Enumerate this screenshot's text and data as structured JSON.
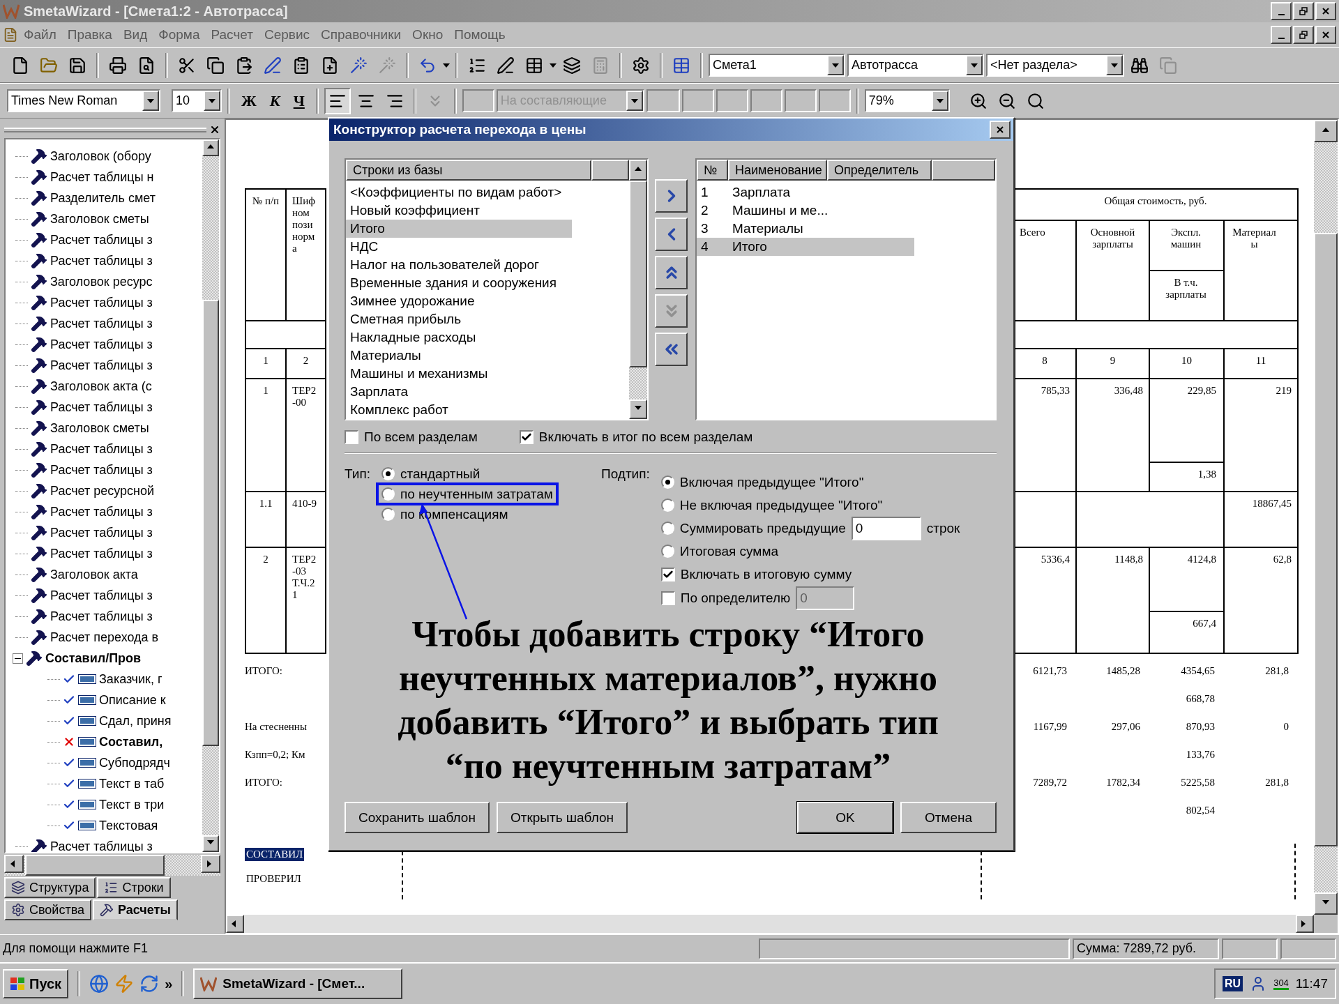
{
  "window": {
    "title": "SmetaWizard - [Смета1:2 - Автотрасса]"
  },
  "menu": [
    "Файл",
    "Правка",
    "Вид",
    "Форма",
    "Расчет",
    "Сервис",
    "Справочники",
    "Окно",
    "Помощь"
  ],
  "toolbar": {
    "combos": [
      {
        "value": "Смета1"
      },
      {
        "value": "Автотрасса"
      },
      {
        "value": "<Нет раздела>"
      }
    ]
  },
  "format_bar": {
    "font": "Times New Roman",
    "size": "10",
    "styles": [
      {
        "label": "Ж",
        "kind": "bold"
      },
      {
        "label": "К",
        "kind": "italic"
      },
      {
        "label": "Ч",
        "kind": "underline"
      }
    ],
    "alignment": [
      {
        "kind": "left",
        "selected": true
      },
      {
        "kind": "center",
        "selected": false
      },
      {
        "kind": "right",
        "selected": false
      }
    ],
    "component_combo": {
      "value": "На составляющие",
      "disabled": true
    },
    "zoom": "79%"
  },
  "tree": {
    "items": [
      {
        "label": "Заголовок (обору",
        "bold": false
      },
      {
        "label": "Расчет таблицы н",
        "bold": false
      },
      {
        "label": "Разделитель смет",
        "bold": false
      },
      {
        "label": "Заголовок сметы",
        "bold": false
      },
      {
        "label": "Расчет таблицы з",
        "bold": false
      },
      {
        "label": "Расчет таблицы з",
        "bold": false
      },
      {
        "label": "Заголовок ресурс",
        "bold": false
      },
      {
        "label": "Расчет таблицы з",
        "bold": false
      },
      {
        "label": "Расчет таблицы з",
        "bold": false
      },
      {
        "label": "Расчет таблицы з",
        "bold": false
      },
      {
        "label": "Расчет таблицы з",
        "bold": false
      },
      {
        "label": "Заголовок акта (с",
        "bold": false
      },
      {
        "label": "Расчет таблицы з",
        "bold": false
      },
      {
        "label": "Заголовок сметы",
        "bold": false
      },
      {
        "label": "Расчет таблицы з",
        "bold": false
      },
      {
        "label": "Расчет таблицы з",
        "bold": false
      },
      {
        "label": "Расчет ресурсной",
        "bold": false
      },
      {
        "label": "Расчет таблицы з",
        "bold": false
      },
      {
        "label": "Расчет таблицы з",
        "bold": false
      },
      {
        "label": "Расчет таблицы з",
        "bold": false
      },
      {
        "label": "Заголовок акта",
        "bold": false
      },
      {
        "label": "Расчет таблицы з",
        "bold": false
      },
      {
        "label": "Расчет таблицы з",
        "bold": false
      },
      {
        "label": "Расчет перехода в",
        "bold": false
      },
      {
        "label": "Составил/Пров",
        "bold": true,
        "expanded": true,
        "children": [
          {
            "label": "Заказчик, г",
            "kind": "ok",
            "bold": false
          },
          {
            "label": "Описание к",
            "kind": "ok",
            "bold": false
          },
          {
            "label": "Сдал, приня",
            "kind": "ok",
            "bold": false
          },
          {
            "label": "Составил,",
            "kind": "error",
            "bold": true
          },
          {
            "label": "Субподрядч",
            "kind": "ok",
            "bold": false
          },
          {
            "label": "Текст в таб",
            "kind": "ok",
            "bold": false
          },
          {
            "label": "Текст в три",
            "kind": "ok",
            "bold": false
          },
          {
            "label": "Текстовая",
            "kind": "ok",
            "bold": false
          }
        ]
      },
      {
        "label": "Расчет таблицы з",
        "bold": false
      }
    ]
  },
  "panel_tabs": [
    {
      "label": "Структура",
      "selected": false
    },
    {
      "label": "Строки",
      "selected": false
    },
    {
      "label": "Свойства",
      "selected": false
    },
    {
      "label": "Расчеты",
      "selected": true
    }
  ],
  "document": {
    "table_left": {
      "header_number": "№ п/п",
      "header_code": [
        "Шиф",
        "ном",
        "пози",
        "норм",
        "а"
      ],
      "numbers": [
        "1",
        "2"
      ],
      "rows": [
        {
          "number": "1",
          "code": [
            "ТЕР2",
            "-00"
          ]
        },
        {
          "number": "1.1",
          "code": [
            "410-9"
          ]
        },
        {
          "number": "2",
          "code": [
            "ТЕР2",
            "-03",
            "Т.Ч.2",
            "1"
          ]
        }
      ]
    },
    "table_right": {
      "group_header": "Общая стоимость, руб.",
      "columns": [
        "Всего",
        "Основной зарплаты",
        "Экспл. машин",
        "Материалы"
      ],
      "sub_header": "В т.ч. зарплаты",
      "numbers": [
        "8",
        "9",
        "10",
        "11"
      ],
      "rows": [
        {
          "kind": "split",
          "cells": [
            "785,33",
            "336,48",
            "229,85",
            "219"
          ],
          "sub": "1,38"
        },
        {
          "kind": "merged",
          "cells": [
            "",
            "",
            "",
            "18867,45"
          ]
        },
        {
          "kind": "split",
          "cells": [
            "5336,4",
            "1148,8",
            "4124,8",
            "62,8"
          ],
          "sub": "667,4"
        }
      ]
    },
    "totals": [
      {
        "label": "ИТОГО:",
        "cells": [
          "6121,73",
          "1485,28",
          "4354,65",
          "281,8"
        ]
      },
      {
        "cells": [
          null,
          null,
          "668,78",
          null
        ]
      },
      {
        "label": "На стесненны",
        "cells": [
          "1167,99",
          "297,06",
          "870,93",
          "0"
        ]
      },
      {
        "label": "Кзпп=0,2; Км",
        "cells": [
          null,
          null,
          "133,76",
          null
        ]
      },
      {
        "label": "ИТОГО:",
        "cells": [
          "7289,72",
          "1782,34",
          "5225,58",
          "281,8"
        ]
      },
      {
        "cells": [
          null,
          null,
          "802,54",
          null
        ]
      }
    ],
    "signatures": [
      {
        "label": "СОСТАВИЛ",
        "selected": true
      },
      {
        "label": "ПРОВЕРИЛ",
        "selected": false
      }
    ]
  },
  "dialog": {
    "title": "Конструктор расчета перехода в цены",
    "source_list": {
      "header": "Строки из базы",
      "items": [
        {
          "label": "<Коэффициенты по видам работ>",
          "selected": false
        },
        {
          "label": "Новый коэффициент",
          "selected": false
        },
        {
          "label": "Итого",
          "selected": true
        },
        {
          "label": "НДС",
          "selected": false
        },
        {
          "label": "Налог на пользователей дорог",
          "selected": false
        },
        {
          "label": "Временные здания и сооружения",
          "selected": false
        },
        {
          "label": "Зимнее удорожание",
          "selected": false
        },
        {
          "label": "Сметная прибыль",
          "selected": false
        },
        {
          "label": "Накладные расходы",
          "selected": false
        },
        {
          "label": "Материалы",
          "selected": false
        },
        {
          "label": "Машины и механизмы",
          "selected": false
        },
        {
          "label": "Зарплата",
          "selected": false
        },
        {
          "label": "Комплекс работ",
          "selected": false
        }
      ]
    },
    "move_buttons": [
      {
        "kind": "add",
        "disabled": false
      },
      {
        "kind": "remove",
        "disabled": false
      },
      {
        "kind": "up",
        "disabled": false
      },
      {
        "kind": "down",
        "disabled": true
      },
      {
        "kind": "remove_all",
        "disabled": false
      }
    ],
    "target_list": {
      "columns": [
        "№",
        "Наименование",
        "Определитель"
      ],
      "rows": [
        {
          "number": "1",
          "name": "Зарплата",
          "selected": false
        },
        {
          "number": "2",
          "name": "Машины и ме...",
          "selected": false
        },
        {
          "number": "3",
          "name": "Материалы",
          "selected": false
        },
        {
          "number": "4",
          "name": "Итого",
          "selected": true
        }
      ]
    },
    "options": [
      {
        "label": "По всем разделам",
        "checked": false
      },
      {
        "label": "Включать в итог по всем разделам",
        "checked": true
      }
    ],
    "type": {
      "label": "Тип:",
      "options": [
        {
          "label": "стандартный",
          "selected": true,
          "highlighted": false
        },
        {
          "label": "по неучтенным затратам",
          "selected": false,
          "highlighted": true
        },
        {
          "label": "по компенсациям",
          "selected": false,
          "highlighted": false
        }
      ]
    },
    "subtype": {
      "label": "Подтип:",
      "options": [
        {
          "label": "Включая предыдущее \"Итого\"",
          "selected": true
        },
        {
          "label": "Не включая предыдущее \"Итого\"",
          "selected": false
        },
        {
          "label": "Суммировать предыдущие",
          "selected": false,
          "field": "0",
          "suffix": "строк"
        },
        {
          "label": "Итоговая сумма",
          "selected": false
        }
      ],
      "checks": [
        {
          "label": "Включать в итоговую сумму",
          "checked": true
        },
        {
          "label": "По определителю",
          "checked": false,
          "field": "0",
          "field_disabled": true
        }
      ]
    },
    "template_buttons": [
      "Сохранить шаблон",
      "Открыть шаблон"
    ],
    "buttons": [
      {
        "label": "OK",
        "default": true
      },
      {
        "label": "Отмена",
        "default": false
      }
    ]
  },
  "annotation": {
    "text": "Чтобы добавить строку “Итого неучтенных материалов”, нужно добавить “Итого” и выбрать тип “по неучтенным затратам”"
  },
  "status_bar": {
    "help": "Для помощи нажмите F1",
    "sum": "Сумма: 7289,72 руб."
  },
  "taskbar": {
    "start": "Пуск",
    "more": "»",
    "task": "SmetaWizard - [Смет...",
    "language": "RU",
    "badge": "304",
    "clock": "11:47"
  }
}
